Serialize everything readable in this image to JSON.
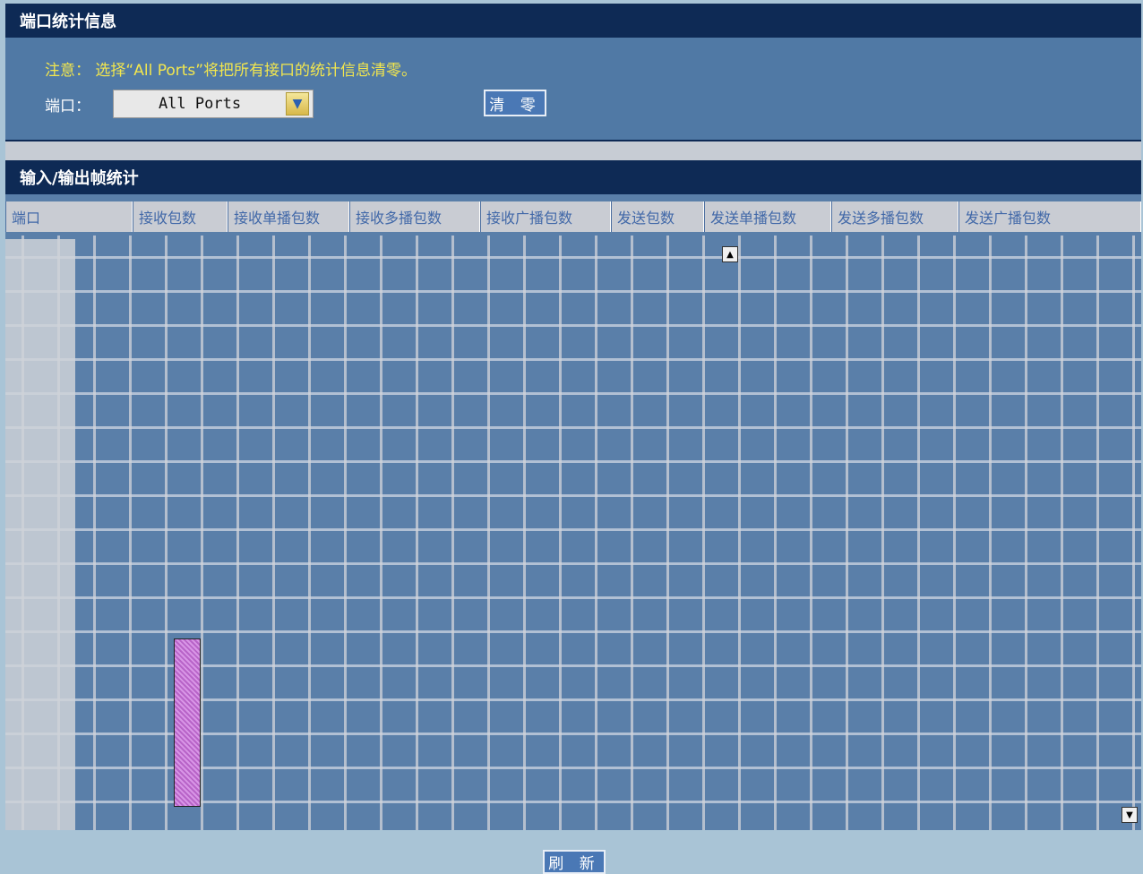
{
  "section1": {
    "title": "端口统计信息"
  },
  "notice": "注意： 选择“All Ports”将把所有接口的统计信息清零。",
  "port": {
    "label": "端口：",
    "selected": "All Ports"
  },
  "buttons": {
    "clear": "清 零",
    "refresh": "刷 新"
  },
  "section2": {
    "title": "输入/输出帧统计"
  },
  "table": {
    "columns": [
      "端口",
      "接收包数",
      "接收单播包数",
      "接收多播包数",
      "接收广播包数",
      "发送包数",
      "发送单播包数",
      "发送多播包数",
      "发送广播包数"
    ]
  },
  "colors": {
    "title_bg": "#0e2a55",
    "panel_bg": "#5079a5",
    "notice_text": "#f2e64e",
    "table_bg": "#5a7fa9"
  }
}
